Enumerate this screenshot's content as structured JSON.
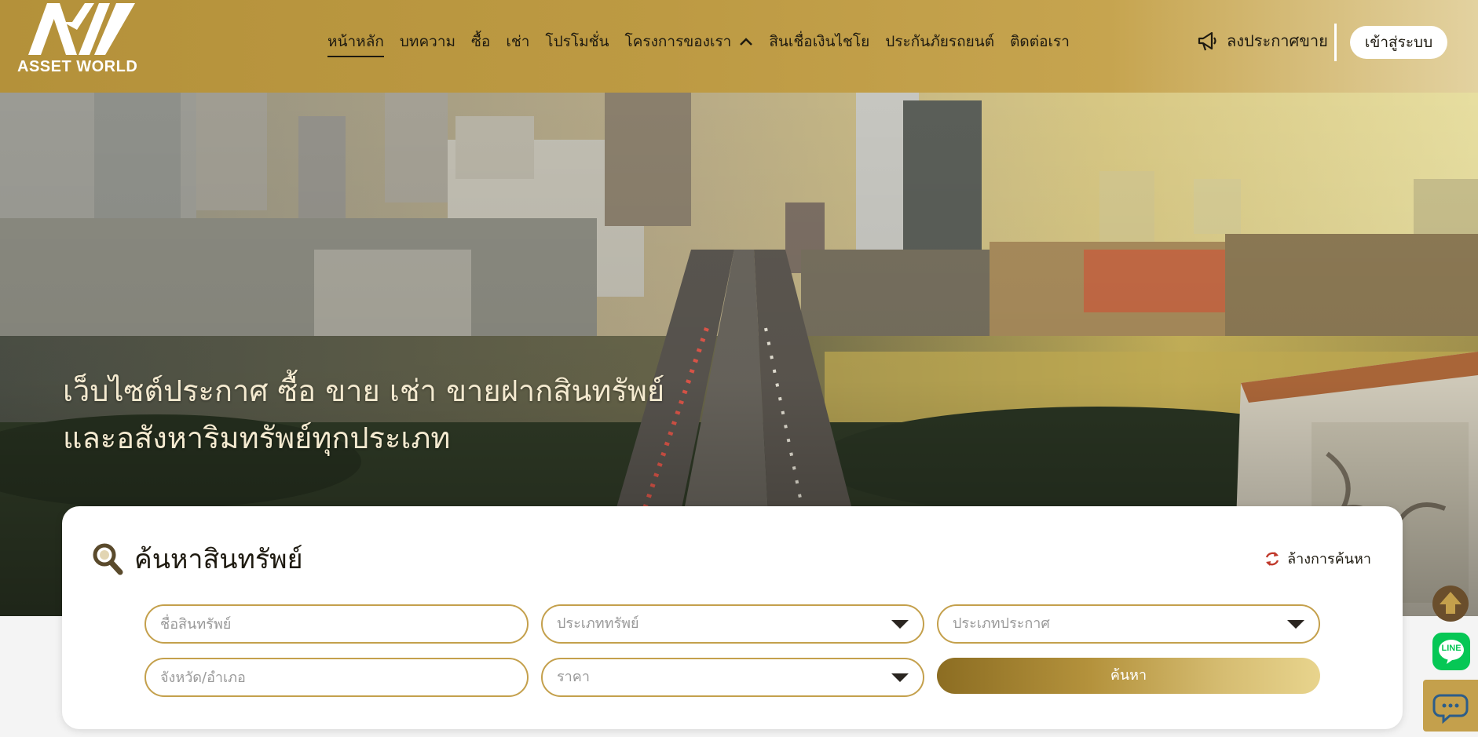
{
  "brand": {
    "name": "ASSET WORLD"
  },
  "nav": {
    "items": [
      {
        "label": "หน้าหลัก",
        "active": true
      },
      {
        "label": "บทความ"
      },
      {
        "label": "ซื้อ"
      },
      {
        "label": "เช่า"
      },
      {
        "label": "โปรโมชั่น"
      },
      {
        "label": "โครงการของเรา",
        "has_dropdown": true
      },
      {
        "label": "สินเชื่อเงินไชโย"
      },
      {
        "label": "ประกันภัยรถยนต์"
      },
      {
        "label": "ติดต่อเรา"
      }
    ],
    "post_label": "ลงประกาศขาย",
    "login_label": "เข้าสู่ระบบ"
  },
  "hero": {
    "line1": "เว็บไซต์ประกาศ ซื้อ ขาย เช่า ขายฝากสินทรัพย์",
    "line2": "และอสังหาริมทรัพย์ทุกประเภท"
  },
  "search": {
    "title": "ค้นหาสินทรัพย์",
    "reset_label": "ล้างการค้นหา",
    "asset_name_placeholder": "ชื่อสินทรัพย์",
    "asset_type_placeholder": "ประเภททรัพย์",
    "listing_type_placeholder": "ประเภทประกาศ",
    "location_placeholder": "จังหวัด/อำเภอ",
    "price_placeholder": "ราคา",
    "submit_label": "ค้นหา"
  },
  "floating": {
    "line_label": "LINE"
  },
  "colors": {
    "gold": "#c4a04c",
    "header_gold": "#b4913a",
    "line_green": "#06c755",
    "text_dark": "#1e1a10"
  }
}
